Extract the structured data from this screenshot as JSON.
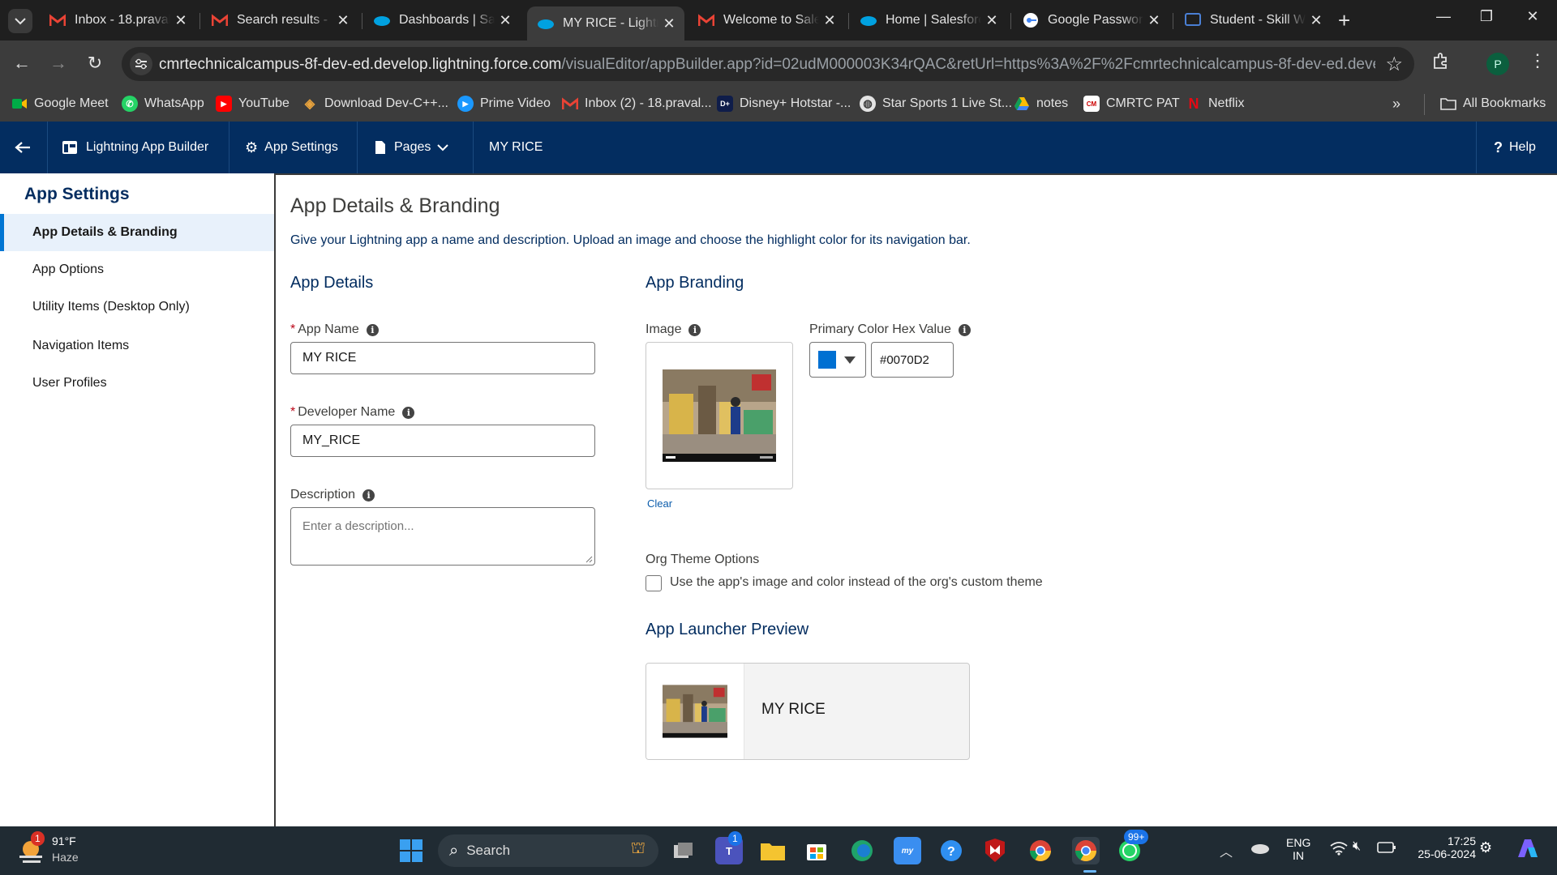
{
  "browser": {
    "tabs": [
      {
        "title": "Inbox - 18.praval",
        "icon": "gmail-icon"
      },
      {
        "title": "Search results - 1",
        "icon": "gmail-icon"
      },
      {
        "title": "Dashboards | Sal",
        "icon": "salesforce-cloud-icon"
      },
      {
        "title": "MY RICE - Lightn",
        "icon": "salesforce-cloud-icon",
        "active": true
      },
      {
        "title": "Welcome to Sale",
        "icon": "gmail-icon"
      },
      {
        "title": "Home | Salesforc",
        "icon": "salesforce-cloud-icon"
      },
      {
        "title": "Google Passwor",
        "icon": "google-password-icon"
      },
      {
        "title": "Student - Skill W",
        "icon": "skill-wallet-icon"
      }
    ],
    "url_host": "cmrtechnicalcampus-8f-dev-ed.develop.lightning.force.com",
    "url_path": "/visualEditor/appBuilder.app?id=02udM000003K34rQAC&retUrl=https%3A%2F%2Fcmrtechnicalcampus-8f-dev-ed.develop.lightning....",
    "profile_initial": "P",
    "bookmarks": [
      {
        "label": "Google Meet",
        "icon": "google-meet-icon"
      },
      {
        "label": "WhatsApp",
        "icon": "whatsapp-icon"
      },
      {
        "label": "YouTube",
        "icon": "youtube-icon"
      },
      {
        "label": "Download Dev-C++...",
        "icon": "devcpp-icon"
      },
      {
        "label": "Prime Video",
        "icon": "prime-video-icon"
      },
      {
        "label": "Inbox (2) - 18.praval...",
        "icon": "gmail-icon"
      },
      {
        "label": "Disney+ Hotstar -...",
        "icon": "hotstar-icon"
      },
      {
        "label": "Star Sports 1 Live St...",
        "icon": "globe-icon"
      },
      {
        "label": "notes",
        "icon": "google-drive-icon"
      },
      {
        "label": "CMRTC PAT",
        "icon": "cmrtc-icon"
      },
      {
        "label": "Netflix",
        "icon": "netflix-icon"
      }
    ],
    "all_bookmarks": "All Bookmarks"
  },
  "header": {
    "builder": "Lightning App Builder",
    "app_settings": "App Settings",
    "pages": "Pages",
    "app_name": "MY RICE",
    "help": "Help"
  },
  "sidebar": {
    "title": "App Settings",
    "items": [
      {
        "label": "App Details & Branding",
        "active": true
      },
      {
        "label": "App Options"
      },
      {
        "label": "Utility Items (Desktop Only)"
      },
      {
        "label": "Navigation Items"
      },
      {
        "label": "User Profiles"
      }
    ]
  },
  "main": {
    "title": "App Details & Branding",
    "subtitle": "Give your Lightning app a name and description. Upload an image and choose the highlight color for its navigation bar.",
    "details": {
      "heading": "App Details",
      "app_name_label": "App Name",
      "app_name_value": "MY RICE",
      "dev_name_label": "Developer Name",
      "dev_name_value": "MY_RICE",
      "description_label": "Description",
      "description_placeholder": "Enter a description..."
    },
    "branding": {
      "heading": "App Branding",
      "image_label": "Image",
      "clear": "Clear",
      "color_label": "Primary Color Hex Value",
      "color_value": "#0070D2",
      "org_theme_label": "Org Theme Options",
      "org_theme_checkbox": "Use the app's image and color instead of the org's custom theme",
      "preview_heading": "App Launcher Preview",
      "preview_name": "MY RICE"
    }
  },
  "colors": {
    "primary": "#0070D2",
    "header_bg": "#032d60"
  },
  "taskbar": {
    "weather_temp": "91°F",
    "weather_cond": "Haze",
    "weather_badge": "1",
    "search": "Search",
    "teams_badge": "1",
    "whatsapp_badge": "99+",
    "lang1": "ENG",
    "lang2": "IN",
    "time": "17:25",
    "date": "25-06-2024"
  }
}
